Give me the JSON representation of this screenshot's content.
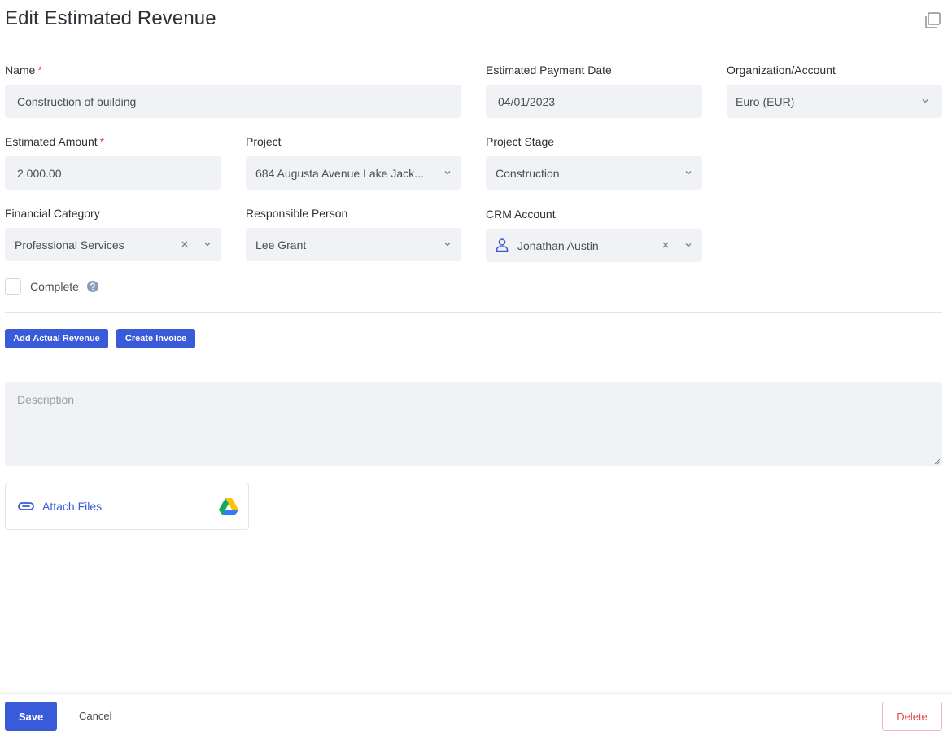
{
  "header": {
    "title": "Edit Estimated Revenue",
    "icon": "copy-window-icon"
  },
  "form": {
    "name": {
      "label": "Name",
      "required_mark": "*",
      "value": "Construction of building"
    },
    "estimated_payment_date": {
      "label": "Estimated Payment Date",
      "value": "04/01/2023"
    },
    "organization_account": {
      "label": "Organization/Account",
      "value": "Euro (EUR)"
    },
    "estimated_amount": {
      "label": "Estimated Amount",
      "required_mark": "*",
      "value": "2 000.00"
    },
    "project": {
      "label": "Project",
      "value": "684 Augusta Avenue Lake Jack..."
    },
    "project_stage": {
      "label": "Project Stage",
      "value": "Construction"
    },
    "financial_category": {
      "label": "Financial Category",
      "value": "Professional Services"
    },
    "responsible_person": {
      "label": "Responsible Person",
      "value": "Lee Grant"
    },
    "crm_account": {
      "label": "CRM Account",
      "value": "Jonathan Austin",
      "icon": "person-icon"
    },
    "complete": {
      "label": "Complete",
      "checked": false
    },
    "description": {
      "placeholder": "Description",
      "value": ""
    }
  },
  "actions": {
    "add_actual_revenue": "Add Actual Revenue",
    "create_invoice": "Create Invoice"
  },
  "attachments": {
    "label": "Attach Files",
    "icons": [
      "paperclip-icon",
      "google-drive-icon"
    ]
  },
  "footer": {
    "save": "Save",
    "cancel": "Cancel",
    "delete": "Delete"
  },
  "colors": {
    "primary": "#3a5bd9",
    "danger": "#e5484d",
    "field_bg": "#f1f2f6",
    "border": "#e3e5ea"
  }
}
